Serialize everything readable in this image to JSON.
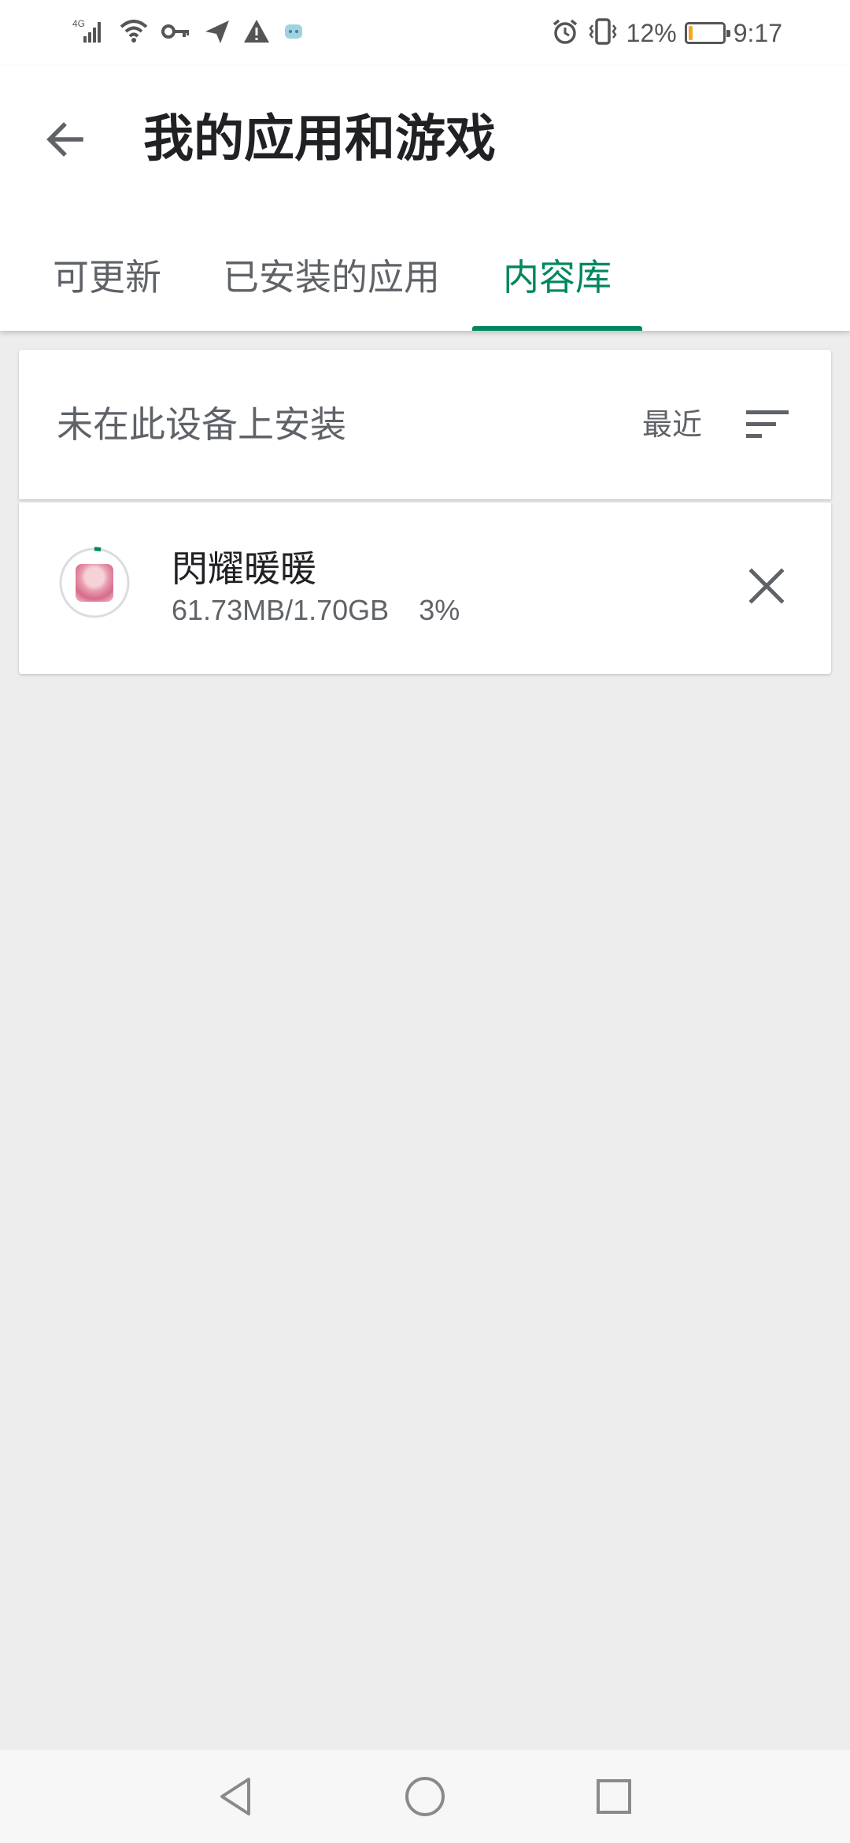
{
  "status_bar": {
    "network": "4G",
    "battery_percent": "12%",
    "battery_level": 0.12,
    "time": "9:17",
    "icons": [
      "signal-icon",
      "wifi-icon",
      "vpn-key-icon",
      "send-icon",
      "warning-icon",
      "app-notification-icon",
      "alarm-icon",
      "vibrate-icon",
      "battery-icon"
    ]
  },
  "header": {
    "title": "我的应用和游戏",
    "back_icon": "arrow-back-icon"
  },
  "tabs": [
    {
      "label": "可更新",
      "active": false
    },
    {
      "label": "已安装的应用",
      "active": false
    },
    {
      "label": "内容库",
      "active": true
    }
  ],
  "library": {
    "section_title": "未在此设备上安装",
    "sort_label": "最近",
    "sort_icon": "sort-icon",
    "items": [
      {
        "name": "閃耀暖暖",
        "downloaded": "61.73MB",
        "total": "1.70GB",
        "size_text": "61.73MB/1.70GB",
        "percent_text": "3%",
        "progress": 0.03,
        "cancel_icon": "close-icon"
      }
    ]
  },
  "nav_bar": {
    "icons": [
      "nav-back-icon",
      "nav-home-icon",
      "nav-recents-icon"
    ]
  },
  "colors": {
    "accent": "#01875f",
    "background": "#ededed",
    "battery_low": "#f5a623"
  }
}
